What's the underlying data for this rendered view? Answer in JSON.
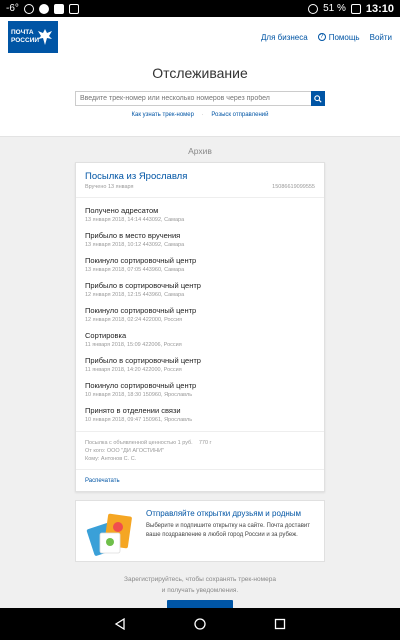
{
  "status_bar": {
    "signal": "-6°",
    "battery": "51 %",
    "time": "13:10"
  },
  "header": {
    "logo_text": "ПОЧТА РОССИИ",
    "nav": {
      "business": "Для бизнеса",
      "help": "Помощь",
      "login": "Войти"
    }
  },
  "tracking": {
    "title": "Отслеживание",
    "search_placeholder": "Введите трек-номер или несколько номеров через пробел",
    "link_how": "Как узнать трек-номер",
    "link_wanted": "Розыск отправлений"
  },
  "archive_label": "Архив",
  "parcel": {
    "title": "Посылка из Ярославля",
    "delivered": "Вручено 13 января",
    "track_id": "15086619099555",
    "events": [
      {
        "title": "Получено адресатом",
        "detail": "13 января 2018, 14:14 443092, Самара"
      },
      {
        "title": "Прибыло в место вручения",
        "detail": "13 января 2018, 10:12 443092, Самара"
      },
      {
        "title": "Покинуло сортировочный центр",
        "detail": "13 января 2018, 07:05 443960, Самара"
      },
      {
        "title": "Прибыло в сортировочный центр",
        "detail": "12 января 2018, 12:15 443960, Самара"
      },
      {
        "title": "Покинуло сортировочный центр",
        "detail": "12 января 2018, 02:24 422000, Россия"
      },
      {
        "title": "Сортировка",
        "detail": "11 января 2018, 15:09 422006, Россия"
      },
      {
        "title": "Прибыло в сортировочный центр",
        "detail": "11 января 2018, 14:20 422000, Россия"
      },
      {
        "title": "Покинуло сортировочный центр",
        "detail": "10 января 2018, 18:30 150960, Ярославль"
      },
      {
        "title": "Принято в отделении связи",
        "detail": "10 января 2018, 09:47 150961, Ярославль"
      }
    ],
    "info_value": "Посылка с объявленной ценностью 1 руб.",
    "info_weight": "770 г",
    "info_from": "От кого: ООО \"ДИ АГОСТИНИ\"",
    "info_to": "Кому: Антонов С. С.",
    "details_link": "Распечатать"
  },
  "promo": {
    "title": "Отправляйте открытки друзьям и родным",
    "text": "Выберите и подпишите открытку на сайте. Почта доставит ваше поздравление в любой город России и за рубеж."
  },
  "register": {
    "line1": "Зарегистрируйтесь, чтобы сохранять трек-номера",
    "line2": "и получать уведомления."
  },
  "colors": {
    "brand": "#0055a5",
    "background": "#f0f0f0"
  },
  "icons": [
    "search-icon",
    "help-icon",
    "postcard-illustration",
    "back-icon",
    "home-icon",
    "recents-icon"
  ]
}
